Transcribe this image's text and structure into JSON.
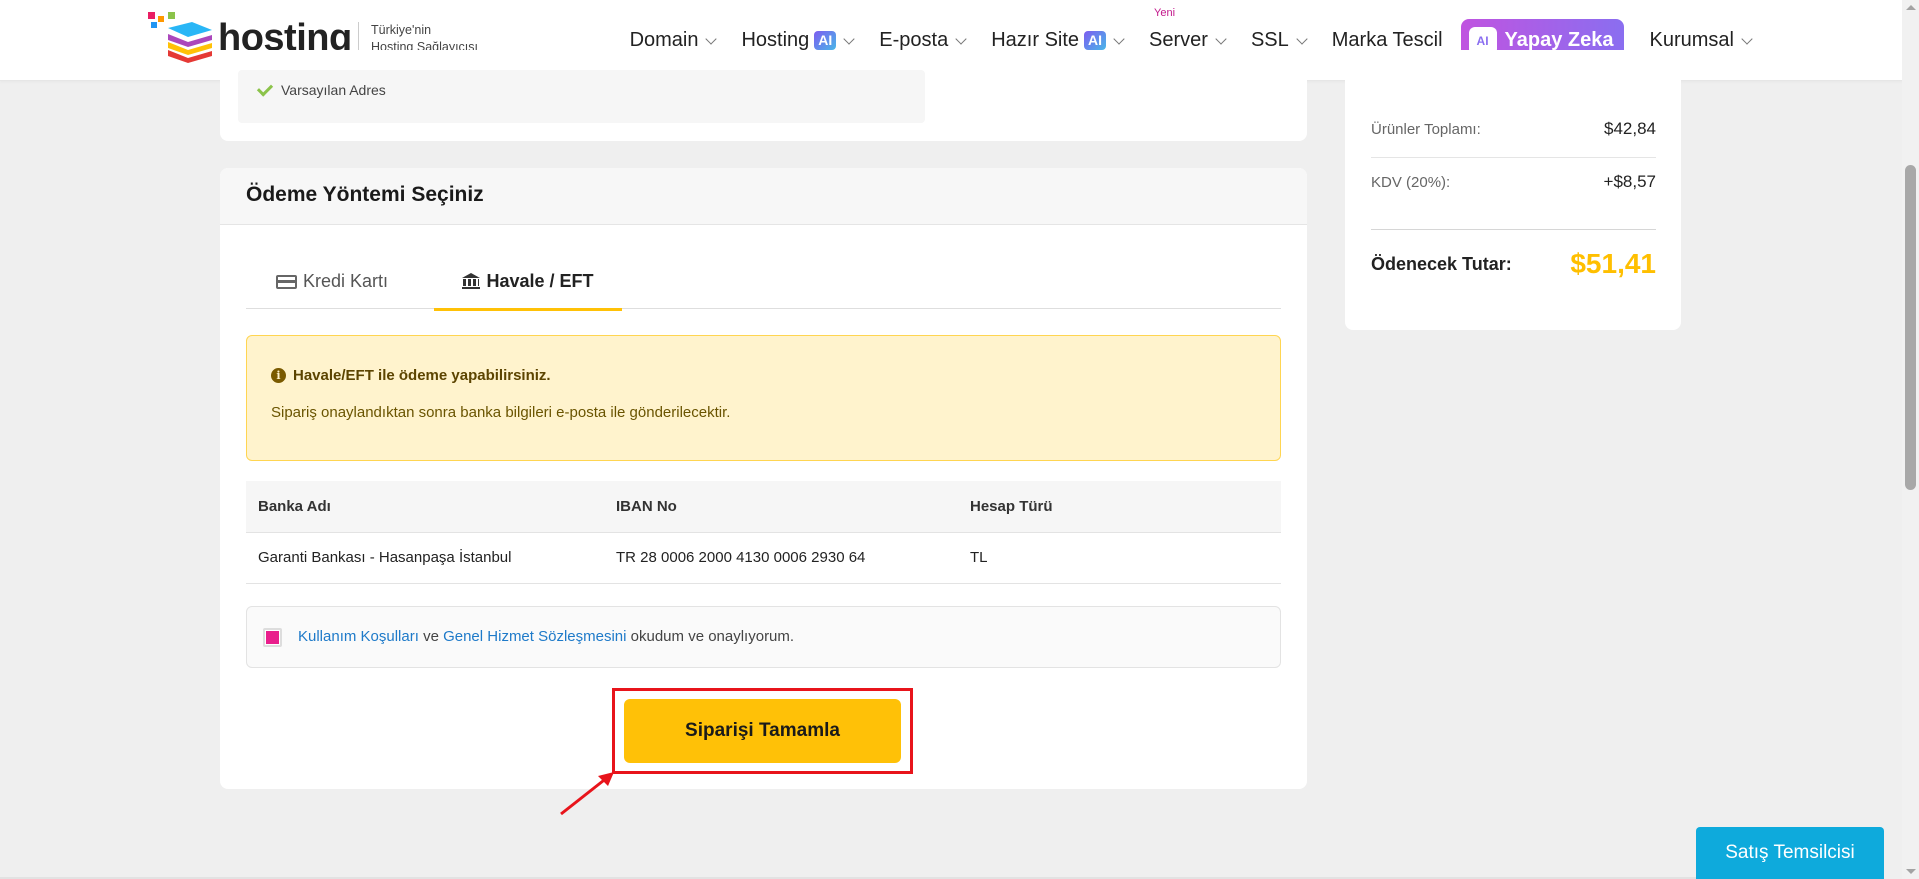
{
  "header": {
    "logo_text": "hosting",
    "tagline_line1": "Türkiye'nin",
    "tagline_line2": "Hosting Sağlayıcısı",
    "nav": {
      "domain": "Domain",
      "hosting": "Hosting",
      "eposta": "E-posta",
      "hazir_site": "Hazır Site",
      "server": "Server",
      "server_badge": "Yeni",
      "ssl": "SSL",
      "marka": "Marka Tescil",
      "yapay_zeka": "Yapay Zeka",
      "kurumsal": "Kurumsal",
      "ai_badge": "AI"
    }
  },
  "address": {
    "default_label": "Varsayılan Adres"
  },
  "payment": {
    "title": "Ödeme Yöntemi Seçiniz",
    "tabs": {
      "credit_card": "Kredi Kartı",
      "bank_transfer": "Havale / EFT"
    },
    "alert": {
      "title": "Havale/EFT ile ödeme yapabilirsiniz.",
      "text": "Sipariş onaylandıktan sonra banka bilgileri e-posta ile gönderilecektir."
    },
    "bank_table": {
      "headers": {
        "bank": "Banka Adı",
        "iban": "IBAN No",
        "account_type": "Hesap Türü"
      },
      "rows": [
        {
          "bank": "Garanti Bankası - Hasanpaşa İstanbul",
          "iban": "TR 28 0006 2000 4130 0006 2930 64",
          "account_type": "TL"
        }
      ]
    },
    "terms": {
      "link1": "Kullanım Koşulları",
      "and": "ve",
      "link2": "Genel Hizmet Sözleşmesini",
      "suffix": "okudum ve onaylıyorum."
    },
    "submit_label": "Siparişi Tamamla"
  },
  "summary": {
    "subtotal_label": "Ürünler Toplamı:",
    "subtotal_value": "$42,84",
    "tax_label": "KDV (20%):",
    "tax_value": "+$8,57",
    "total_label": "Ödenecek Tutar:",
    "total_value": "$51,41"
  },
  "sales_button": "Satış Temsilcisi",
  "colors": {
    "accent": "#ffc107",
    "highlight": "#e8141b",
    "link": "#1e7ac9",
    "sales": "#0eaadc"
  }
}
